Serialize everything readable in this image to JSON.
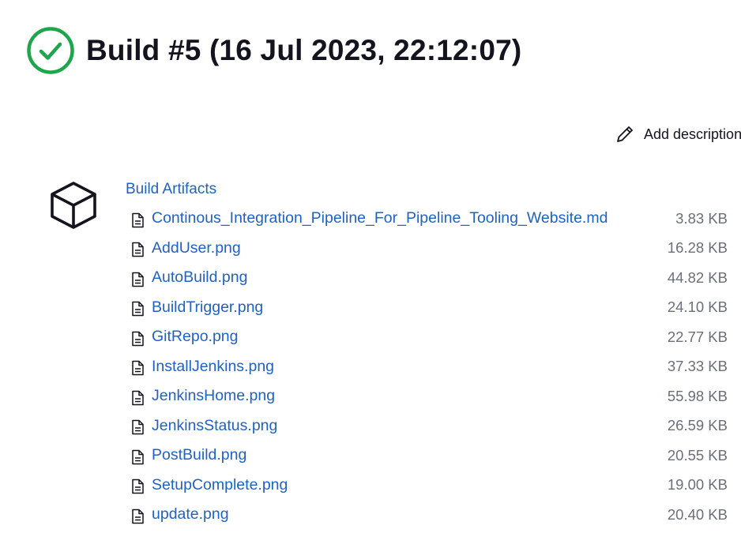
{
  "header": {
    "title": "Build #5 (16 Jul 2023, 22:12:07)",
    "status_icon": "check-circle-icon",
    "status_color": "#1ea64b"
  },
  "actions": {
    "add_description_label": "Add description",
    "add_description_icon": "pencil-icon"
  },
  "artifacts": {
    "icon": "package-box-icon",
    "title": "Build Artifacts",
    "link_color": "#1f62c4",
    "files": [
      {
        "name": "Continous_Integration_Pipeline_For_Pipeline_Tooling_Website.md",
        "size": "3.83 KB"
      },
      {
        "name": "AddUser.png",
        "size": "16.28 KB"
      },
      {
        "name": "AutoBuild.png",
        "size": "44.82 KB"
      },
      {
        "name": "BuildTrigger.png",
        "size": "24.10 KB"
      },
      {
        "name": "GitRepo.png",
        "size": "22.77 KB"
      },
      {
        "name": "InstallJenkins.png",
        "size": "37.33 KB"
      },
      {
        "name": "JenkinsHome.png",
        "size": "55.98 KB"
      },
      {
        "name": "JenkinsStatus.png",
        "size": "26.59 KB"
      },
      {
        "name": "PostBuild.png",
        "size": "20.55 KB"
      },
      {
        "name": "SetupComplete.png",
        "size": "19.00 KB"
      },
      {
        "name": "update.png",
        "size": "20.40 KB"
      }
    ]
  }
}
